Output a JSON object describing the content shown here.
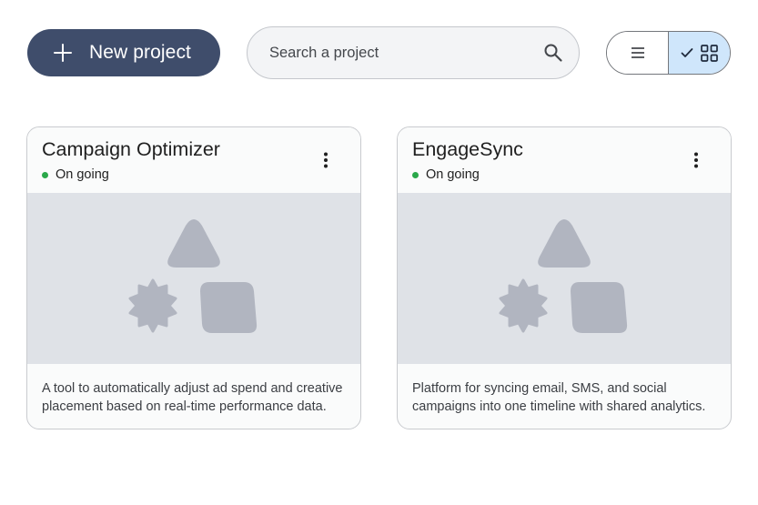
{
  "toolbar": {
    "new_project_label": "New project",
    "search_placeholder": "Search a project",
    "search_value": "",
    "view_mode": "grid"
  },
  "colors": {
    "primary_button": "#3f4d6b",
    "selected_toggle": "#cfe6fb",
    "status_ongoing": "#2aa84a",
    "media_placeholder": "#dfe2e7",
    "placeholder_shapes": "#b1b5c0"
  },
  "icons": {
    "new_project": "plus-icon",
    "search": "search-icon",
    "list_view": "list-icon",
    "grid_selected": "check-icon",
    "grid_view": "grid-icon",
    "card_menu": "more-vert-icon",
    "card_media": "shapes-placeholder-icon"
  },
  "projects": [
    {
      "title": "Campaign Optimizer",
      "status": "On going",
      "description": "A tool to automatically adjust ad spend and creative placement based on real-time performance data."
    },
    {
      "title": "EngageSync",
      "status": "On going",
      "description": "Platform for syncing email, SMS, and social campaigns into one timeline with shared analytics."
    }
  ]
}
